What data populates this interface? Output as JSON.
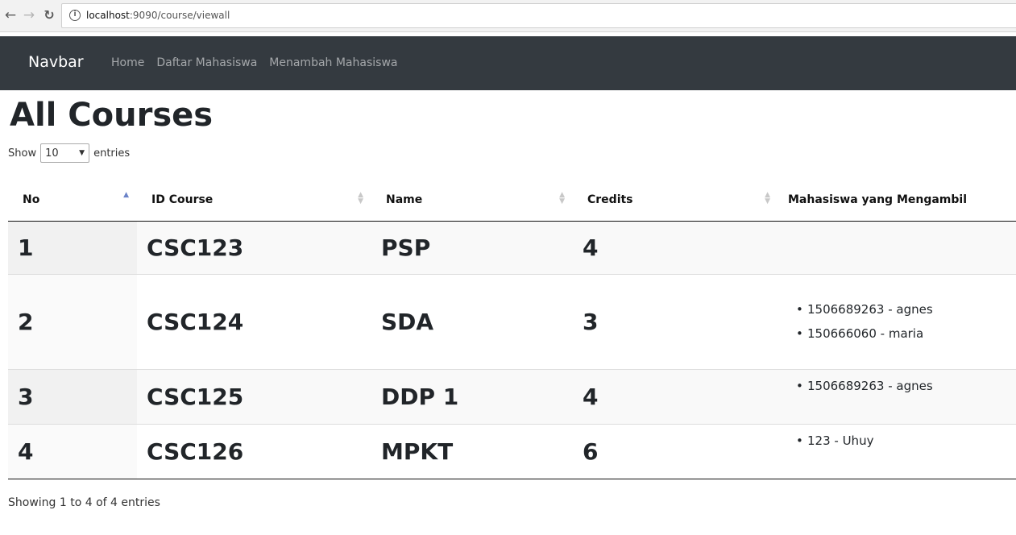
{
  "browser": {
    "url_host": "localhost",
    "url_path": ":9090/course/viewall"
  },
  "navbar": {
    "brand": "Navbar",
    "links": [
      "Home",
      "Daftar Mahasiswa",
      "Menambah Mahasiswa"
    ]
  },
  "page": {
    "title": "All Courses"
  },
  "length": {
    "show_label": "Show",
    "selected": "10",
    "entries_label": "entries"
  },
  "table": {
    "headers": [
      "No",
      "ID Course",
      "Name",
      "Credits",
      "Mahasiswa yang Mengambil"
    ],
    "rows": [
      {
        "no": "1",
        "id": "CSC123",
        "name": "PSP",
        "credits": "4",
        "students": []
      },
      {
        "no": "2",
        "id": "CSC124",
        "name": "SDA",
        "credits": "3",
        "students": [
          "1506689263 - agnes",
          "150666060 - maria"
        ]
      },
      {
        "no": "3",
        "id": "CSC125",
        "name": "DDP 1",
        "credits": "4",
        "students": [
          "1506689263 - agnes"
        ]
      },
      {
        "no": "4",
        "id": "CSC126",
        "name": "MPKT",
        "credits": "6",
        "students": [
          "123 - Uhuy"
        ]
      }
    ]
  },
  "info": "Showing 1 to 4 of 4 entries"
}
